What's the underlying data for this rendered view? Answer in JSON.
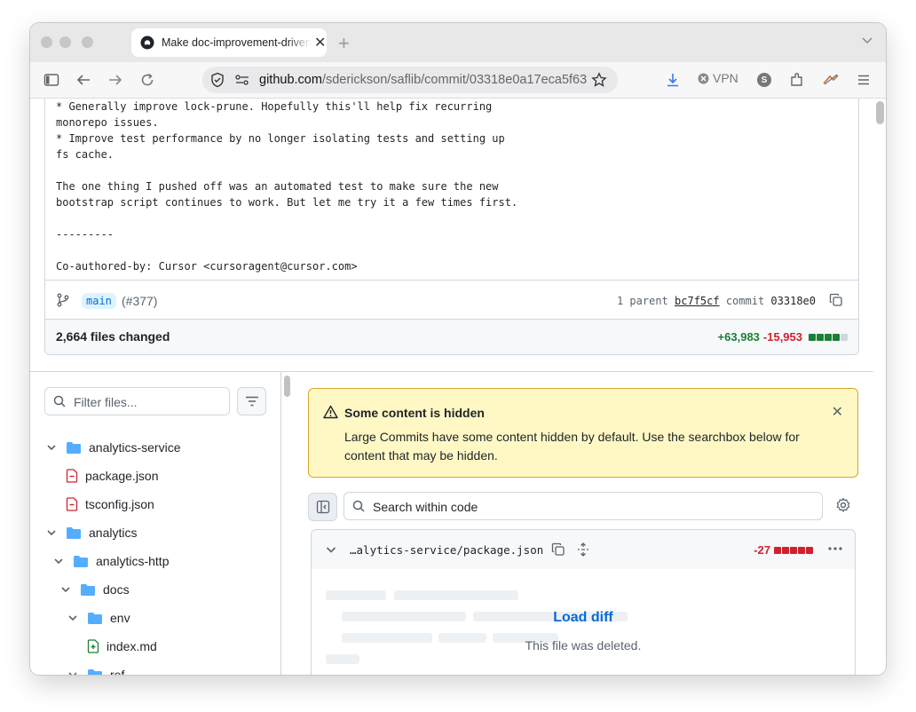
{
  "browser": {
    "tab_title": "Make doc-improvement-driven changes",
    "url_domain": "github.com",
    "url_path": "/sderickson/saflib/commit/03318e0a17eca5f63",
    "vpn_label": "VPN",
    "profile_letter": "S"
  },
  "commit": {
    "message_lines": "* Generally improve lock-prune. Hopefully this'll help fix recurring\nmonorepo issues.\n* Improve test performance by no longer isolating tests and setting up\nfs cache.\n\nThe one thing I pushed off was an automated test to make sure the new\nbootstrap script continues to work. But let me try it a few times first.\n\n---------\n\nCo-authored-by: Cursor <cursoragent@cursor.com>",
    "branch": "main",
    "pr": "(#377)",
    "parent_prefix": "1 parent",
    "parent_sha": "bc7f5cf",
    "commit_label": "commit",
    "commit_sha": "03318e0",
    "files_changed": "2,664 files changed",
    "additions": "+63,983",
    "deletions": "-15,953",
    "diffstat_colors": [
      "#1a7f37",
      "#1a7f37",
      "#1a7f37",
      "#1a7f37",
      "#d0d7de"
    ]
  },
  "file_tree": {
    "filter_placeholder": "Filter files...",
    "items": [
      {
        "label": "analytics-service",
        "type": "folder",
        "depth": 0
      },
      {
        "label": "package.json",
        "type": "file-deleted",
        "depth": 1
      },
      {
        "label": "tsconfig.json",
        "type": "file-deleted",
        "depth": 1
      },
      {
        "label": "analytics",
        "type": "folder",
        "depth": 0
      },
      {
        "label": "analytics-http",
        "type": "folder",
        "depth": 1
      },
      {
        "label": "docs",
        "type": "folder",
        "depth": 2
      },
      {
        "label": "env",
        "type": "folder",
        "depth": 3
      },
      {
        "label": "index.md",
        "type": "file-added",
        "depth": 4
      },
      {
        "label": "ref",
        "type": "folder",
        "depth": 3
      }
    ]
  },
  "banner": {
    "title": "Some content is hidden",
    "body": "Large Commits have some content hidden by default. Use the searchbox below for content that may be hidden."
  },
  "code_search": {
    "placeholder": "Search within code"
  },
  "diff_file": {
    "name": "…alytics-service/package.json",
    "deletions": "-27",
    "load_label": "Load diff",
    "status": "This file was deleted."
  },
  "colors": {
    "accent": "#0969da",
    "added": "#1a7f37",
    "deleted": "#cf222e",
    "folder": "#54aeff"
  }
}
